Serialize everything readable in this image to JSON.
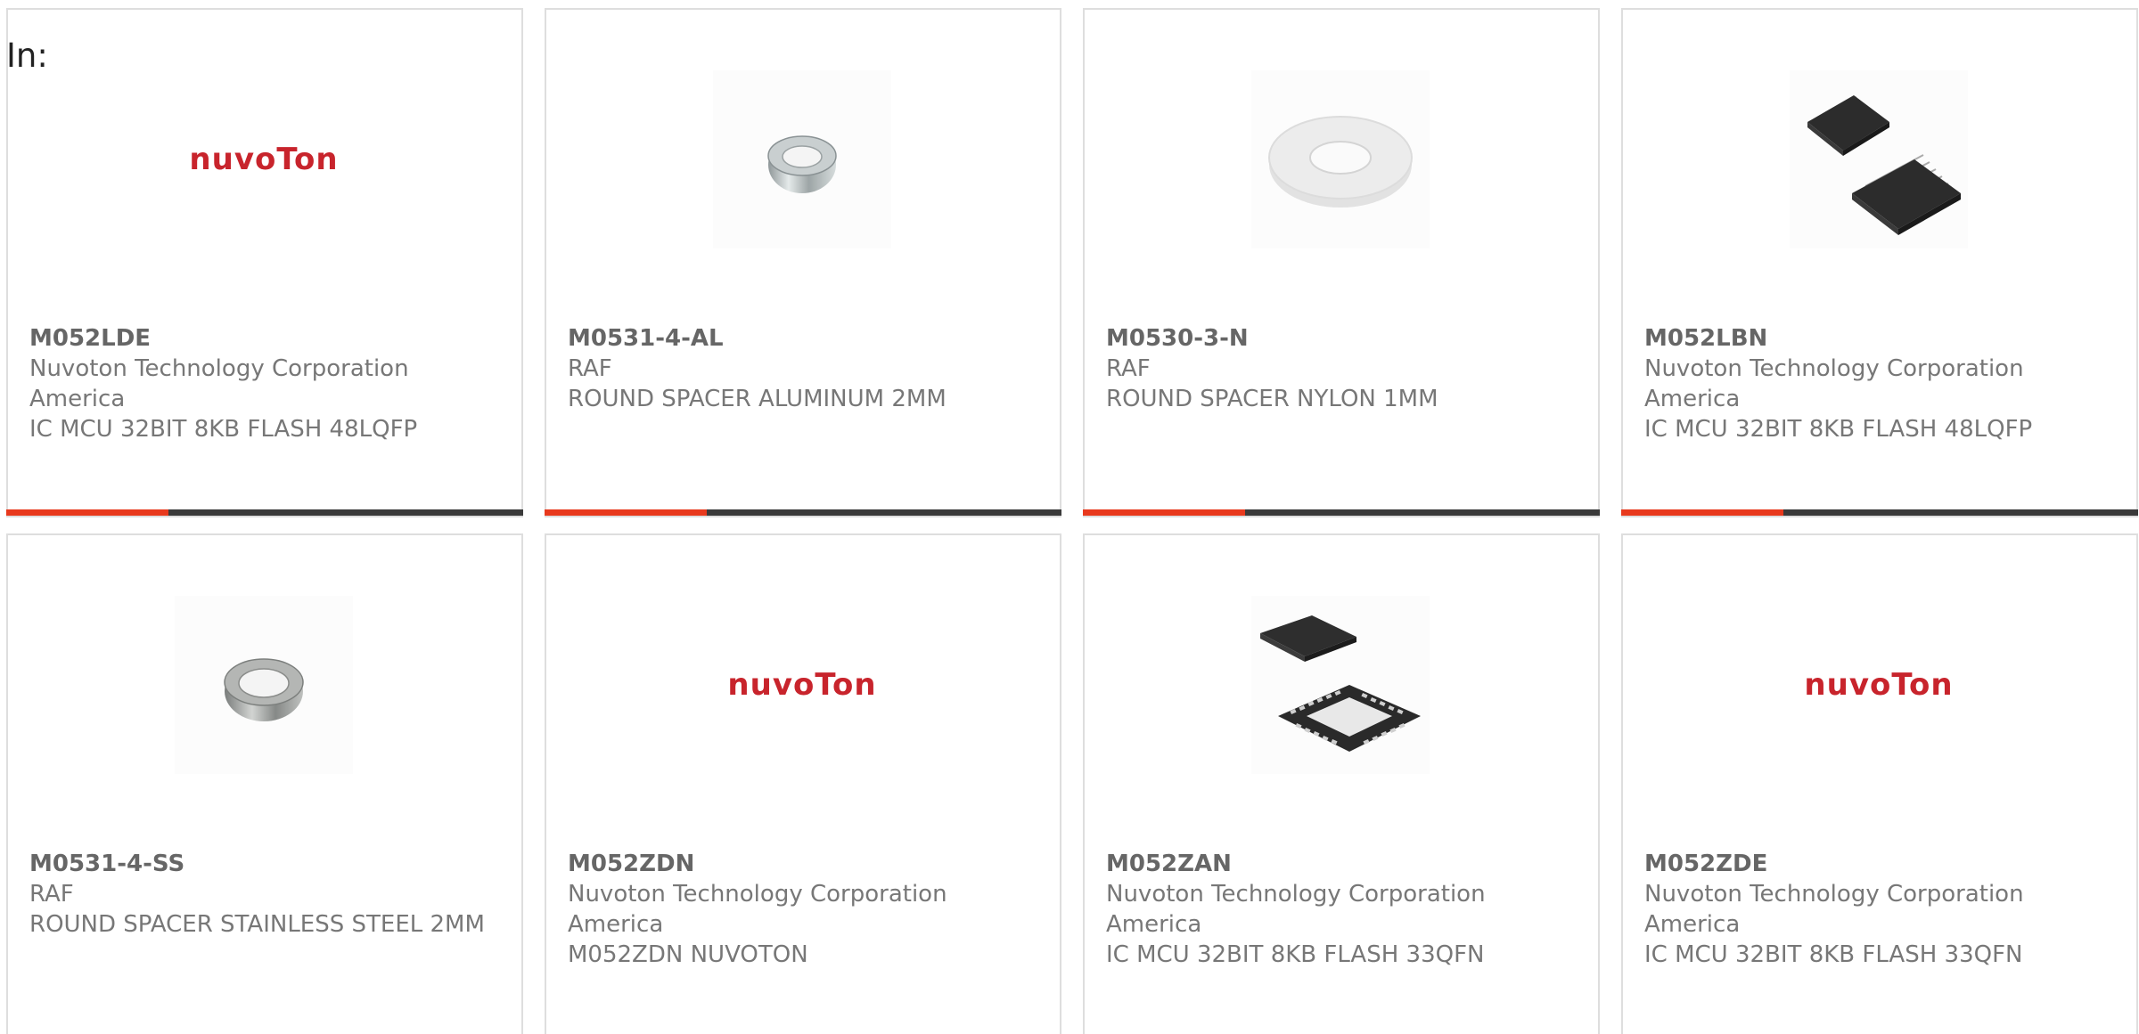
{
  "filter_label": "In:",
  "products": [
    {
      "part": "M052LDE",
      "manufacturer": "Nuvoton Technology Corporation America",
      "description": "IC MCU 32BIT 8KB FLASH 48LQFP",
      "image": "nuvoton-logo",
      "logo_text": "nuvoTon"
    },
    {
      "part": "M0531-4-AL",
      "manufacturer": "RAF",
      "description": "ROUND SPACER ALUMINUM 2MM",
      "image": "aluminum-spacer"
    },
    {
      "part": "M0530-3-N",
      "manufacturer": "RAF",
      "description": "ROUND SPACER NYLON 1MM",
      "image": "nylon-spacer"
    },
    {
      "part": "M052LBN",
      "manufacturer": "Nuvoton Technology Corporation America",
      "description": "IC MCU 32BIT 8KB FLASH 48LQFP",
      "image": "lqfp-chips"
    },
    {
      "part": "M0531-4-SS",
      "manufacturer": "RAF",
      "description": "ROUND SPACER STAINLESS STEEL 2MM",
      "image": "steel-spacer"
    },
    {
      "part": "M052ZDN",
      "manufacturer": "Nuvoton Technology Corporation America",
      "description": "M052ZDN NUVOTON",
      "image": "nuvoton-logo",
      "logo_text": "nuvoTon"
    },
    {
      "part": "M052ZAN",
      "manufacturer": "Nuvoton Technology Corporation America",
      "description": "IC MCU 32BIT 8KB FLASH 33QFN",
      "image": "qfn-chips"
    },
    {
      "part": "M052ZDE",
      "manufacturer": "Nuvoton Technology Corporation America",
      "description": "IC MCU 32BIT 8KB FLASH 33QFN",
      "image": "nuvoton-logo",
      "logo_text": "nuvoTon"
    }
  ],
  "colors": {
    "accent": "#e8391d",
    "bar": "#3a3a3a",
    "logo": "#c8242c"
  }
}
